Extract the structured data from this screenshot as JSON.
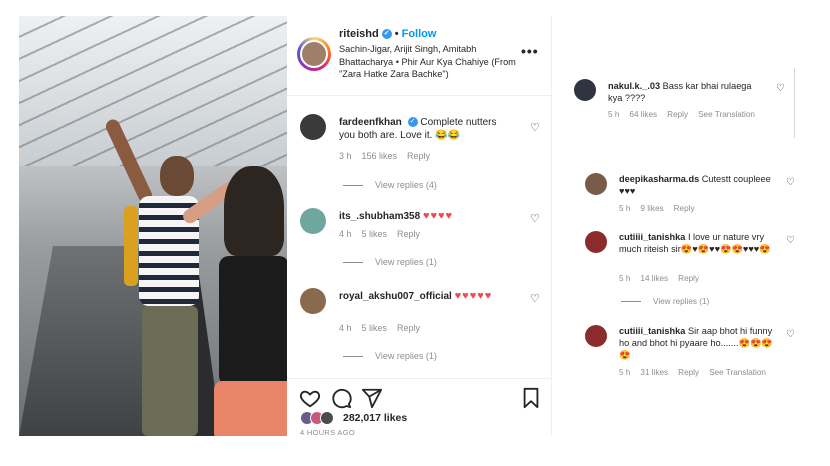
{
  "post": {
    "username": "riteishd",
    "follow_label": "Follow",
    "audio": "Sachin-Jigar, Arijit Singh, Amitabh Bhattacharya • Phir Aur Kya Chahiye (From \"Zara Hatke Zara Bachke\")",
    "more_label": "•••",
    "likes": "282,017 likes",
    "time_ago": "4 HOURS AGO"
  },
  "comments": [
    {
      "user": "fardeenfkhan",
      "text": "Complete nutters you both are. Love it. 😂😂",
      "time": "3 h",
      "likes": "156 likes",
      "reply": "Reply",
      "view_replies": "View replies (4)"
    },
    {
      "user": "its_.shubham358",
      "text": "♥♥♥♥",
      "time": "4 h",
      "likes": "5 likes",
      "reply": "Reply",
      "view_replies": "View replies (1)"
    },
    {
      "user": "royal_akshu007_official",
      "text": "♥♥♥♥♥",
      "time": "4 h",
      "likes": "5 likes",
      "reply": "Reply",
      "view_replies": "View replies (1)"
    }
  ],
  "right_panel": {
    "top": {
      "user": "nakul.k._.03",
      "text": "Bass kar bhai rulaega kya ????",
      "time": "5 h",
      "likes": "64 likes",
      "reply": "Reply",
      "translate": "See Translation"
    },
    "items": [
      {
        "user": "deepikasharma.ds",
        "text": "Cutestt coupleee ♥♥♥",
        "time": "5 h",
        "likes": "9 likes",
        "reply": "Reply"
      },
      {
        "user": "cutiiii_tanishka",
        "text": "I love ur nature vry much riteish sir😍♥😍♥♥😍😍♥♥♥😍",
        "time": "5 h",
        "likes": "14 likes",
        "reply": "Reply",
        "view_replies": "View replies (1)"
      },
      {
        "user": "cutiiii_tanishka",
        "text": "Sir aap bhot hi funny ho and bhot hi pyaare ho.......😍😍😍😍",
        "time": "5 h",
        "likes": "31 likes",
        "reply": "Reply",
        "translate": "See Translation"
      }
    ]
  },
  "colors": {
    "accent": "#0095f6",
    "verified": "#3897f0",
    "heart": "#ed4956",
    "muted": "#8e8e8e"
  }
}
